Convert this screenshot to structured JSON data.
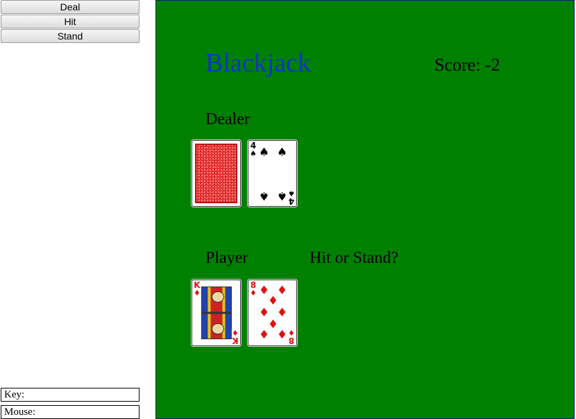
{
  "controls": {
    "deal_label": "Deal",
    "hit_label": "Hit",
    "stand_label": "Stand"
  },
  "info": {
    "key_label": "Key:",
    "mouse_label": "Mouse:"
  },
  "game": {
    "title": "Blackjack",
    "score_text": "Score: -2",
    "dealer_label": "Dealer",
    "player_label": "Player",
    "prompt": "Hit or Stand?",
    "dealer_cards": [
      {
        "face_down": true
      },
      {
        "rank": "4",
        "suit": "♠",
        "color": "black"
      }
    ],
    "player_cards": [
      {
        "rank": "K",
        "suit": "♦",
        "color": "red"
      },
      {
        "rank": "8",
        "suit": "♦",
        "color": "red"
      }
    ]
  },
  "colors": {
    "table": "#008000",
    "title": "#1133cc",
    "red_suit": "#e01010",
    "card_back": "#e02020"
  }
}
